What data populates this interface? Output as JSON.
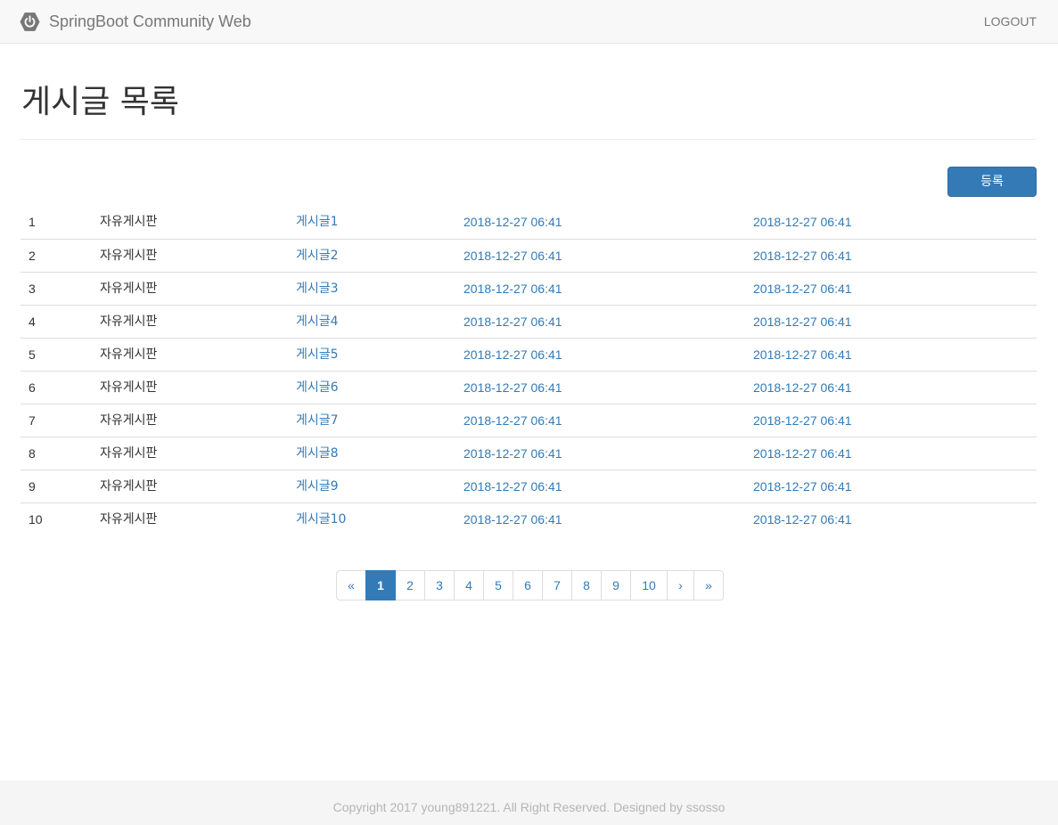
{
  "navbar": {
    "brand_icon": "power-icon",
    "brand": "SpringBoot Community Web",
    "logout": "LOGOUT"
  },
  "page": {
    "title": "게시글 목록"
  },
  "actions": {
    "register": "등록"
  },
  "board": {
    "rows": [
      {
        "num": "1",
        "category": "자유게시판",
        "title": "게시글1",
        "created": "2018-12-27 06:41",
        "updated": "2018-12-27 06:41"
      },
      {
        "num": "2",
        "category": "자유게시판",
        "title": "게시글2",
        "created": "2018-12-27 06:41",
        "updated": "2018-12-27 06:41"
      },
      {
        "num": "3",
        "category": "자유게시판",
        "title": "게시글3",
        "created": "2018-12-27 06:41",
        "updated": "2018-12-27 06:41"
      },
      {
        "num": "4",
        "category": "자유게시판",
        "title": "게시글4",
        "created": "2018-12-27 06:41",
        "updated": "2018-12-27 06:41"
      },
      {
        "num": "5",
        "category": "자유게시판",
        "title": "게시글5",
        "created": "2018-12-27 06:41",
        "updated": "2018-12-27 06:41"
      },
      {
        "num": "6",
        "category": "자유게시판",
        "title": "게시글6",
        "created": "2018-12-27 06:41",
        "updated": "2018-12-27 06:41"
      },
      {
        "num": "7",
        "category": "자유게시판",
        "title": "게시글7",
        "created": "2018-12-27 06:41",
        "updated": "2018-12-27 06:41"
      },
      {
        "num": "8",
        "category": "자유게시판",
        "title": "게시글8",
        "created": "2018-12-27 06:41",
        "updated": "2018-12-27 06:41"
      },
      {
        "num": "9",
        "category": "자유게시판",
        "title": "게시글9",
        "created": "2018-12-27 06:41",
        "updated": "2018-12-27 06:41"
      },
      {
        "num": "10",
        "category": "자유게시판",
        "title": "게시글10",
        "created": "2018-12-27 06:41",
        "updated": "2018-12-27 06:41"
      }
    ]
  },
  "pagination": {
    "first": "«",
    "pages": [
      "1",
      "2",
      "3",
      "4",
      "5",
      "6",
      "7",
      "8",
      "9",
      "10"
    ],
    "active": "1",
    "next": "›",
    "last": "»"
  },
  "footer": {
    "text": "Copyright 2017 young891221. All Right Reserved. Designed by ssosso"
  },
  "colors": {
    "primary": "#337ab7",
    "navbar_bg": "#f8f8f8",
    "footer_bg": "#f5f5f5",
    "muted_text": "#777777"
  }
}
